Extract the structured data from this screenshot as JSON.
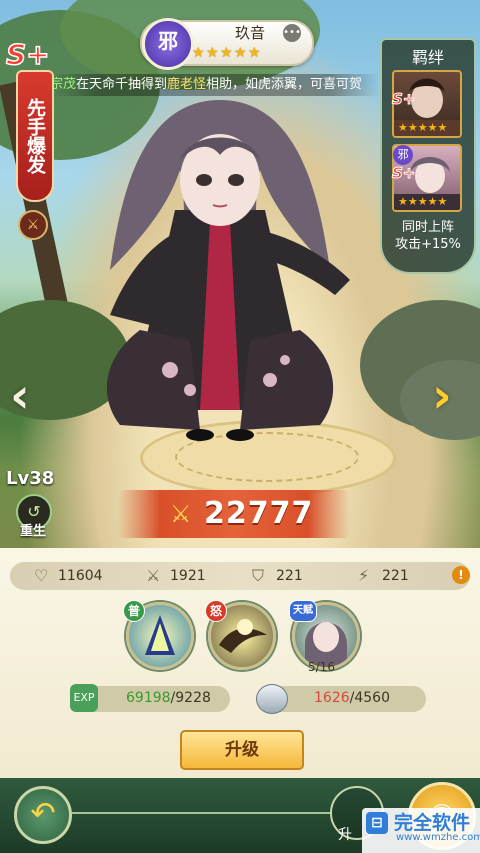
{
  "hero": {
    "faction": "邪",
    "name": "玖音",
    "stars": [
      "★",
      "★",
      "★",
      "★",
      "★"
    ],
    "grade": "S+",
    "banner": "先手爆发",
    "level": "Lv38",
    "rebirth_label": "重生",
    "power": "22777"
  },
  "ticker": {
    "prefix": "宗茂",
    "text_a": "在天命千抽得到",
    "highlight": "鹿老怪",
    "text_b": "相助，如虎添翼，可喜可贺"
  },
  "bond": {
    "title": "羁绊",
    "card1_grade": "S+",
    "card2_faction": "邪",
    "card2_grade": "S+",
    "card_stars": "★★★★★",
    "condition_line1": "同时上阵",
    "condition_line2": "攻击+15%"
  },
  "stats": {
    "hp": "11604",
    "attack": "1921",
    "defense": "221",
    "speed": "221"
  },
  "skills": {
    "normal_badge": "普",
    "rage_badge": "怒",
    "talent_badge": "天赋",
    "talent_progress": "5/16"
  },
  "resources": {
    "exp_current": "69198",
    "exp_required": "/9228",
    "ore_current": "1626",
    "ore_required": "/4560"
  },
  "actions": {
    "upgrade": "升级",
    "bottom_mid": "升"
  },
  "watermark": {
    "text": "完全软件",
    "sub": "www.wmzhe.com"
  },
  "colors": {
    "power_bg": "#e5623a",
    "exp_green": "#3a9a2a",
    "ore_red": "#d84a3a"
  }
}
